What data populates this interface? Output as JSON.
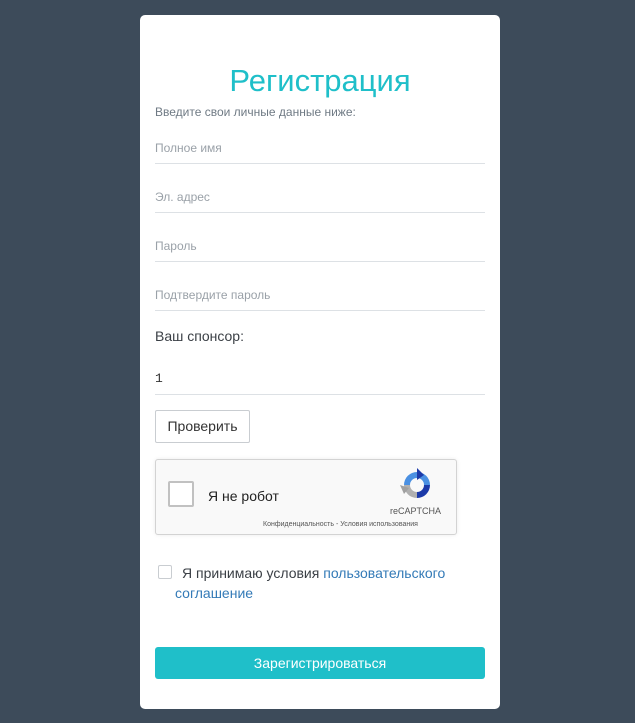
{
  "form": {
    "title": "Регистрация",
    "subtitle": "Введите свои личные данные ниже:",
    "fields": {
      "full_name": {
        "placeholder": "Полное имя",
        "value": ""
      },
      "email": {
        "placeholder": "Эл. адрес",
        "value": ""
      },
      "password": {
        "placeholder": "Пароль",
        "value": ""
      },
      "confirm_password": {
        "placeholder": "Подтвердите пароль",
        "value": ""
      }
    },
    "sponsor": {
      "label": "Ваш спонсор:",
      "value": "1",
      "check_button": "Проверить"
    },
    "recaptcha": {
      "label": "Я не робот",
      "brand": "reCAPTCHA",
      "links": "Конфиденциальность - Условия использования",
      "icon": "recaptcha-logo-icon"
    },
    "terms": {
      "text_before": "Я принимаю условия ",
      "link_text": "пользовательского соглашение",
      "checked": false
    },
    "submit_label": "Зарегистрироваться"
  },
  "colors": {
    "background": "#3d4b5a",
    "accent": "#1fbfc9",
    "link": "#337ab7"
  }
}
